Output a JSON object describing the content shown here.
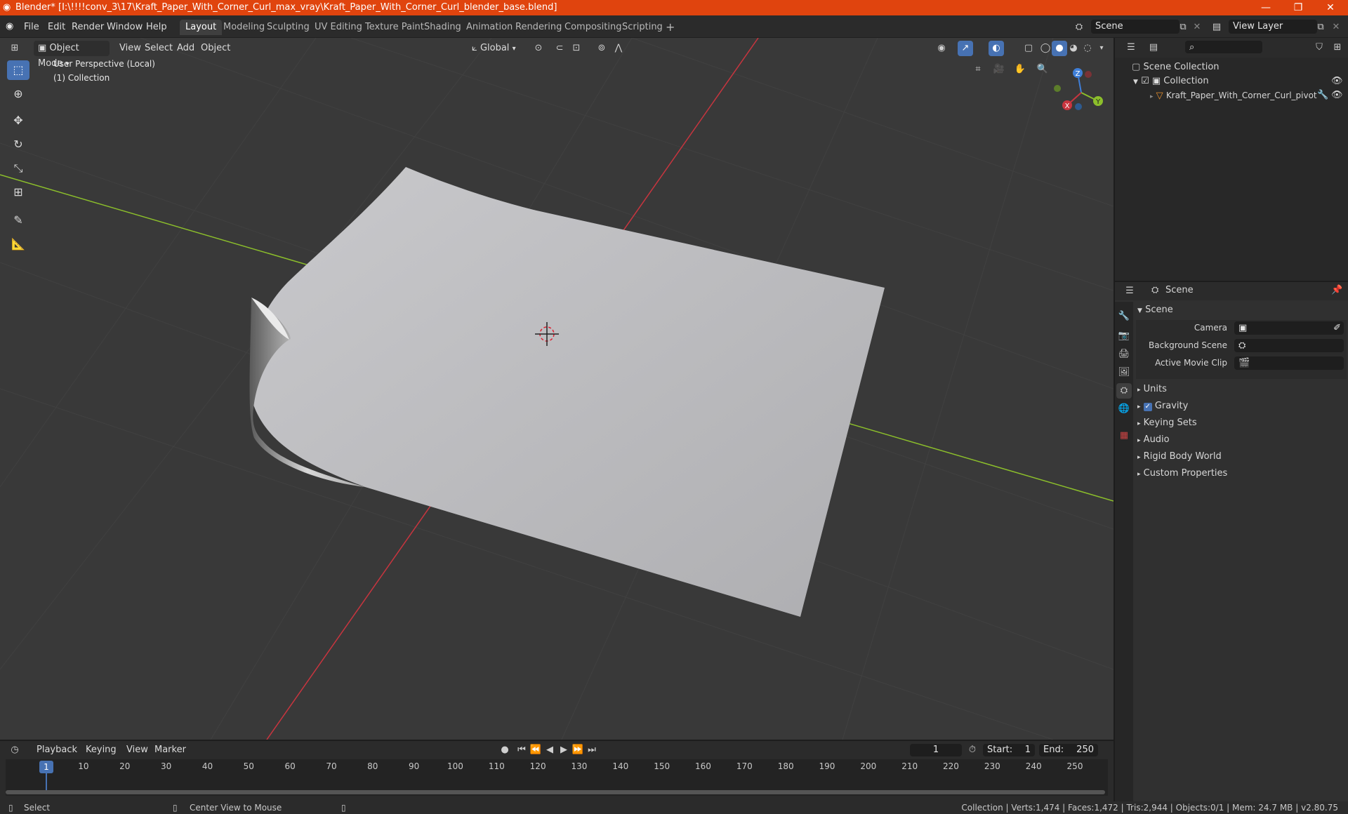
{
  "titlebar": {
    "title": "Blender* [I:\\!!!!conv_3\\17\\Kraft_Paper_With_Corner_Curl_max_vray\\Kraft_Paper_With_Corner_Curl_blender_base.blend]",
    "minimize": "—",
    "restore": "❐",
    "close": "✕"
  },
  "menu": {
    "file": "File",
    "edit": "Edit",
    "render": "Render",
    "window": "Window",
    "help": "Help"
  },
  "workspaces": [
    "Layout",
    "Modeling",
    "Sculpting",
    "UV Editing",
    "Texture Paint",
    "Shading",
    "Animation",
    "Rendering",
    "Compositing",
    "Scripting"
  ],
  "workspace_add": "+",
  "scene_field": "Scene",
  "viewlayer_field": "View Layer",
  "viewport": {
    "mode": "Object Mode",
    "view": "View",
    "select": "Select",
    "add": "Add",
    "object": "Object",
    "orientation": "Global",
    "info_line1": "User Perspective (Local)",
    "info_line2": "(1) Collection",
    "gizmo": {
      "x": "X",
      "y": "Y",
      "z": "Z"
    }
  },
  "outliner": {
    "scene_collection": "Scene Collection",
    "collection": "Collection",
    "object": "Kraft_Paper_With_Corner_Curl_pivot"
  },
  "properties": {
    "header": "Scene",
    "panel": "Scene",
    "camera_label": "Camera",
    "bg_scene_label": "Background Scene",
    "movie_clip_label": "Active Movie Clip",
    "subpanels": [
      "Units",
      "Gravity",
      "Keying Sets",
      "Audio",
      "Rigid Body World",
      "Custom Properties"
    ],
    "gravity_checked": true
  },
  "timeline": {
    "playback": "Playback",
    "keying": "Keying",
    "view": "View",
    "marker": "Marker",
    "current_frame": "1",
    "start_label": "Start:",
    "start": "1",
    "end_label": "End:",
    "end": "250",
    "ticks": [
      "1",
      "10",
      "20",
      "30",
      "40",
      "50",
      "60",
      "70",
      "80",
      "90",
      "100",
      "110",
      "120",
      "130",
      "140",
      "150",
      "160",
      "170",
      "180",
      "190",
      "200",
      "210",
      "220",
      "230",
      "240",
      "250"
    ]
  },
  "statusbar": {
    "select": "Select",
    "center": "Center View to Mouse",
    "stats": "Collection | Verts:1,474 | Faces:1,472 | Tris:2,944 | Objects:0/1 | Mem: 24.7 MB | v2.80.75"
  },
  "colors": {
    "titlebar": "#e0440e",
    "accent": "#4772b3",
    "axis_x": "#c8353f",
    "axis_y": "#8cbf2b",
    "axis_z": "#3f7fd9"
  }
}
